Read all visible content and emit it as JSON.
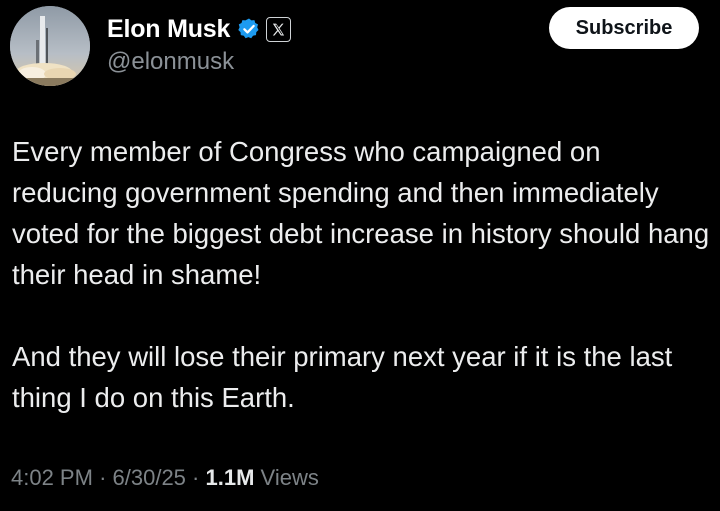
{
  "author": {
    "display_name": "Elon Musk",
    "handle": "@elonmusk",
    "avatar_icon": "rocket-launch-avatar",
    "verified_icon": "verified-check-icon",
    "affiliate_badge": "x-logo-icon",
    "verified_color": "#1d9bf0"
  },
  "subscribe_button": {
    "label": "Subscribe"
  },
  "tweet": {
    "paragraphs": [
      "Every member of Congress who campaigned on reducing government spending and then immediately voted for the biggest debt increase in history should hang their head in shame!",
      "And they will lose their primary next year if it is the last thing I do on this Earth."
    ]
  },
  "meta": {
    "time": "4:02 PM",
    "separator": "·",
    "date": "6/30/25",
    "views_count": "1.1M",
    "views_label": "Views"
  }
}
